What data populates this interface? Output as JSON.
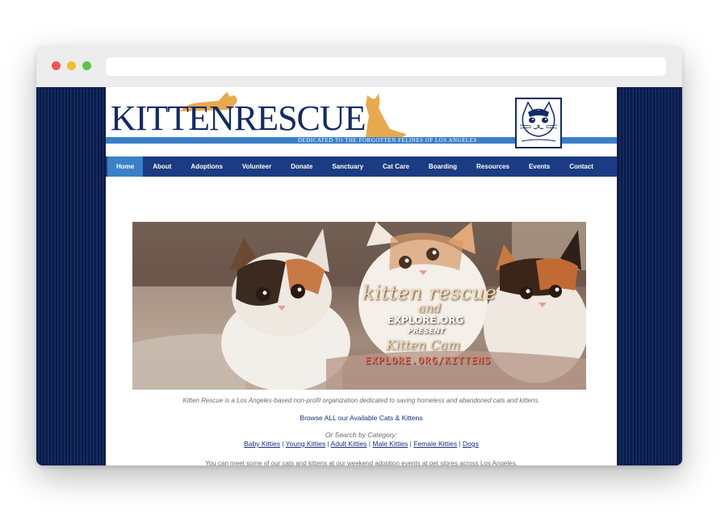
{
  "site": {
    "logo_text_main": "KITTEN",
    "logo_text_second": "RESCUE",
    "tagline": "DEDICATED TO THE FORGOTTEN FELINES OF LOS ANGELES",
    "brand_color": "#142a68",
    "accent_color": "#3b7fc7",
    "cat_color": "#e8a84c"
  },
  "nav": {
    "items": [
      "Home",
      "About",
      "Adoptions",
      "Volunteer",
      "Donate",
      "Sanctuary",
      "Cat Care",
      "Boarding",
      "Resources",
      "Events",
      "Contact"
    ],
    "active_item": "Home"
  },
  "hero": {
    "line1": "kitten rescue",
    "line2": "and",
    "line3": "EXPLORE.ORG",
    "line4": "PRESENT",
    "line5": "Kitten Cam",
    "line6": "EXPLORE.ORG/KITTENS"
  },
  "content": {
    "caption": "Kitten Rescue is a Los Angeles-based non-profit organization dedicated to saving homeless and abandoned cats and kittens.",
    "browse_all": "Browse ALL our Available Cats & Kittens",
    "search_label": "Or Search by Category:",
    "categories": [
      "Baby Kitties",
      "Young Kitties",
      "Adult Kitties",
      "Male Kitties",
      "Female Kitties",
      "Dogs"
    ],
    "separator": " | ",
    "meet": "You can meet some of our cats and kittens at our weekend adoption events at pet stores across Los Angeles."
  }
}
